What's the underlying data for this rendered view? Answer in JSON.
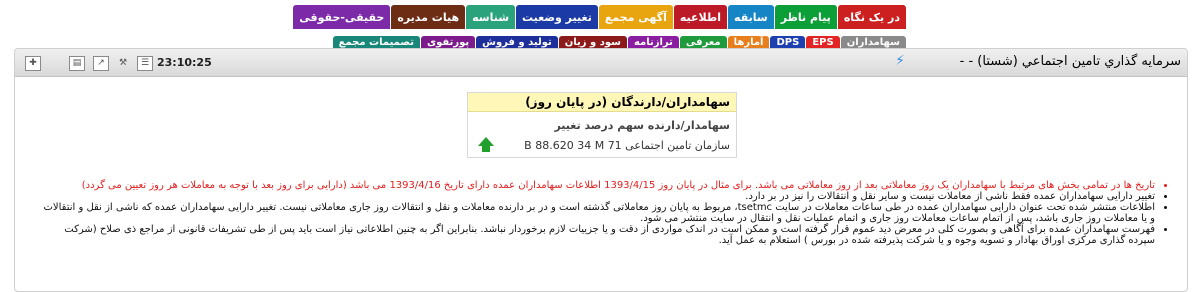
{
  "tabs_row1": [
    {
      "label": "در یک نگاه",
      "bg": "#cc2020"
    },
    {
      "label": "پیام ناظر",
      "bg": "#0c9e37"
    },
    {
      "label": "سابقه",
      "bg": "#1585c6"
    },
    {
      "label": "اطلاعیه",
      "bg": "#bd1a28"
    },
    {
      "label": "آگهی مجمع",
      "bg": "#e8a510"
    },
    {
      "label": "تغییر وضعیت",
      "bg": "#1c3aa6"
    },
    {
      "label": "شناسه",
      "bg": "#2aa37c"
    },
    {
      "label": "هیات مدیره",
      "bg": "#6c2d14"
    },
    {
      "label": "حقیقی-حقوقی",
      "bg": "#7d2aa8"
    }
  ],
  "tabs_row2": [
    {
      "label": "سهامداران",
      "bg": "#8a8a8a"
    },
    {
      "label": "EPS",
      "bg": "#e22424"
    },
    {
      "label": "DPS",
      "bg": "#1d3fb0"
    },
    {
      "label": "آمارها",
      "bg": "#e67f1c"
    },
    {
      "label": "معرفی",
      "bg": "#1f9a3c"
    },
    {
      "label": "ترازنامه",
      "bg": "#8a1ea0"
    },
    {
      "label": "سود و زیان",
      "bg": "#8c1a1a"
    },
    {
      "label": "تولید و فروش",
      "bg": "#1e2f9c"
    },
    {
      "label": "پورتفوی",
      "bg": "#7c1c8c"
    },
    {
      "label": "تصمیمات مجمع",
      "bg": "#19867a"
    }
  ],
  "panel": {
    "title": "سرمايه گذاري تامين اجتماعي (شستا) - -",
    "time": "23:10:25"
  },
  "card": {
    "title": "سهامداران/دارندگان (در پایان روز)",
    "header": "سهامدار/دارنده       سهم   درصد   تغییر",
    "row": "سازمان تامین اجتماعی   71 B   88.620   34 M"
  },
  "notes": [
    {
      "text": "تاریخ ها در تمامی بخش های مرتبط با سهامداران یک روز معاملاتی بعد از روز معاملاتی می باشد. برای مثال در پایان روز 1393/4/15 اطلاعات سهامداران عمده دارای تاریخ 1393/4/16 می باشد (دارایی برای روز بعد با توجه به معاملات هر روز تعیین می گردد)",
      "red": true
    },
    {
      "text": "تغییر دارایی سهامداران عمده فقط ناشی از معاملات نیست و سایر نقل و انتقالات را نیز در بر دارد.",
      "red": false
    },
    {
      "text": "اطلاعات منتشر شده تحت عنوان دارایی سهامداران عمده در طی ساعات معاملات در سایت tsetmc، مربوط به پایان روز معاملاتی گذشته است و در بر دارنده معاملات و نقل و انتقالات روز جاری معاملاتی نیست. تغییر دارایی سهامداران عمده که ناشی از نقل و انتقالات و یا معاملات روز جاری باشد، پس از اتمام ساعات معاملات روز جاری و اتمام عملیات نقل و انتقال در سایت منتشر می شود.",
      "red": false
    },
    {
      "text": "فهرست سهامداران عمده برای آگاهی و بصورت کلی در معرض دید عموم قرار گرفته است و ممکن است در اندک مواردی از دقت و یا جزییات لازم برخوردار نباشد. بنابراین اگر به چنین اطلاعاتی نیاز است باید پس از طی تشریفات قانونی از مراجع ذی صلاح (شرکت سپرده گذاری مرکزی اوراق بهادار و تسویه وجوه و یا شرکت پذیرفته شده در بورس ) استعلام به عمل آید.",
      "red": false
    }
  ]
}
